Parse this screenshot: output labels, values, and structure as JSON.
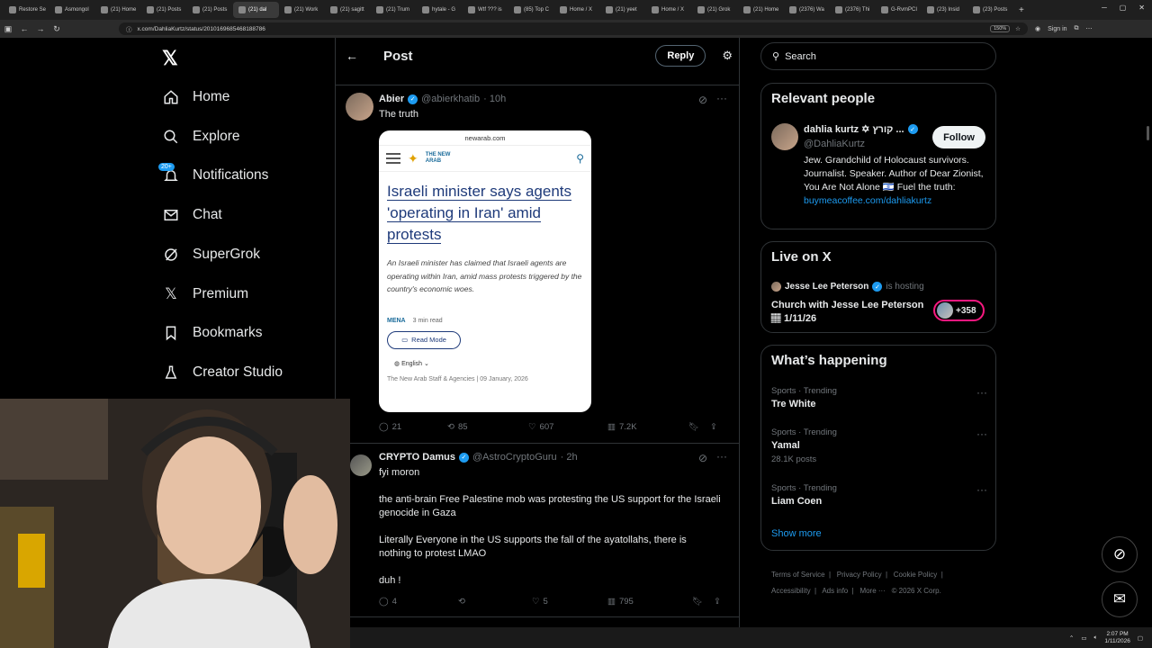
{
  "browser": {
    "tabs": [
      {
        "label": "Restore Se",
        "active": false
      },
      {
        "label": "Asmongol",
        "active": false
      },
      {
        "label": "(21) Home",
        "active": false
      },
      {
        "label": "(21) Posts",
        "active": false
      },
      {
        "label": "(21) Posts",
        "active": false
      },
      {
        "label": "(21) dal",
        "active": true
      },
      {
        "label": "(21) Work",
        "active": false
      },
      {
        "label": "(21) sagitt",
        "active": false
      },
      {
        "label": "(21) Trum",
        "active": false
      },
      {
        "label": "hytale - G",
        "active": false
      },
      {
        "label": "Wtf ??? is",
        "active": false
      },
      {
        "label": "(85) Top C",
        "active": false
      },
      {
        "label": "Home / X",
        "active": false
      },
      {
        "label": "(21) yeet",
        "active": false
      },
      {
        "label": "Home / X",
        "active": false
      },
      {
        "label": "(21) Grok",
        "active": false
      },
      {
        "label": "(21) Home",
        "active": false
      },
      {
        "label": "(2376) Wa",
        "active": false
      },
      {
        "label": "(2376) Thi",
        "active": false
      },
      {
        "label": "G-RvmPCI",
        "active": false
      },
      {
        "label": "(23) Insid",
        "active": false
      },
      {
        "label": "(23) Posts",
        "active": false
      }
    ],
    "url": "x.com/DahliaKurtz/status/2010169685468188786",
    "zoom": "150%",
    "sign_in": "Sign in"
  },
  "nav": {
    "items": [
      {
        "label": "Home",
        "icon": "home-icon"
      },
      {
        "label": "Explore",
        "icon": "search-icon"
      },
      {
        "label": "Notifications",
        "icon": "bell-icon"
      },
      {
        "label": "Chat",
        "icon": "mail-icon"
      },
      {
        "label": "SuperGrok",
        "icon": "grok-icon"
      },
      {
        "label": "Premium",
        "icon": "x-icon"
      },
      {
        "label": "Bookmarks",
        "icon": "bookmark-icon"
      },
      {
        "label": "Creator Studio",
        "icon": "flask-icon"
      }
    ],
    "notif_badge": "20+"
  },
  "header": {
    "title": "Post",
    "reply_label": "Reply"
  },
  "posts": [
    {
      "name": "Abier",
      "handle": "@abierkhatib",
      "time": "· 10h",
      "text": "The truth",
      "card": {
        "domain": "newarab.com",
        "brand": "THE NEW ARAB",
        "headline": "Israeli minister says agents 'operating in Iran' amid protests",
        "summary": "An Israeli minister has claimed that Israeli agents are operating within Iran, amid mass protests triggered by the country's economic woes.",
        "section": "MENA",
        "read_time": "3 min read",
        "read_mode": "Read Mode",
        "language": "English",
        "byline": "The New Arab Staff & Agencies  |  09 January, 2026"
      },
      "metrics": {
        "replies": "21",
        "reposts": "85",
        "likes": "607",
        "views": "7.2K"
      }
    },
    {
      "name": "CRYPTO Damus",
      "handle": "@AstroCryptoGuru",
      "time": "· 2h",
      "paragraphs": [
        "fyi moron",
        "the anti-brain Free Palestine mob was protesting the US support for the Israeli genocide in Gaza",
        "Literally Everyone in the US supports the fall of the ayatollahs, there is nothing to protest LMAO",
        "duh !"
      ],
      "metrics": {
        "replies": "4",
        "reposts": "",
        "likes": "5",
        "views": "795"
      }
    }
  ],
  "right": {
    "search_placeholder": "Search",
    "relevant": {
      "title": "Relevant people",
      "name": "dahlia kurtz ✡ קורץ ...",
      "handle": "@DahliaKurtz",
      "follow": "Follow",
      "bio": "Jew. Grandchild of Holocaust survivors. Journalist. Speaker. Author of Dear Zionist, You Are Not Alone 🇮🇱 Fuel the truth:",
      "link": "buymeacoffee.com/dahliakurtz"
    },
    "live": {
      "title": "Live on X",
      "host": "Jesse Lee Peterson",
      "hosting": "is hosting",
      "event": "Church with Jesse Lee Peterson 🏽 1/11/26",
      "count": "+358"
    },
    "happening": {
      "title": "What’s happening",
      "trends": [
        {
          "category": "Sports · Trending",
          "name": "Tre White",
          "posts": ""
        },
        {
          "category": "Sports · Trending",
          "name": "Yamal",
          "posts": "28.1K posts"
        },
        {
          "category": "Sports · Trending",
          "name": "Liam Coen",
          "posts": ""
        }
      ],
      "show_more": "Show more"
    },
    "footer": {
      "links": [
        "Terms of Service",
        "Privacy Policy",
        "Cookie Policy",
        "Accessibility",
        "Ads info",
        "More ···"
      ],
      "copyright": "© 2026 X Corp."
    }
  },
  "taskbar": {
    "time": "2:07 PM",
    "date": "1/11/2026"
  },
  "colors": {
    "accent": "#1d9bf0",
    "background": "#000000",
    "border": "#2f3336",
    "muted": "#71767b"
  }
}
